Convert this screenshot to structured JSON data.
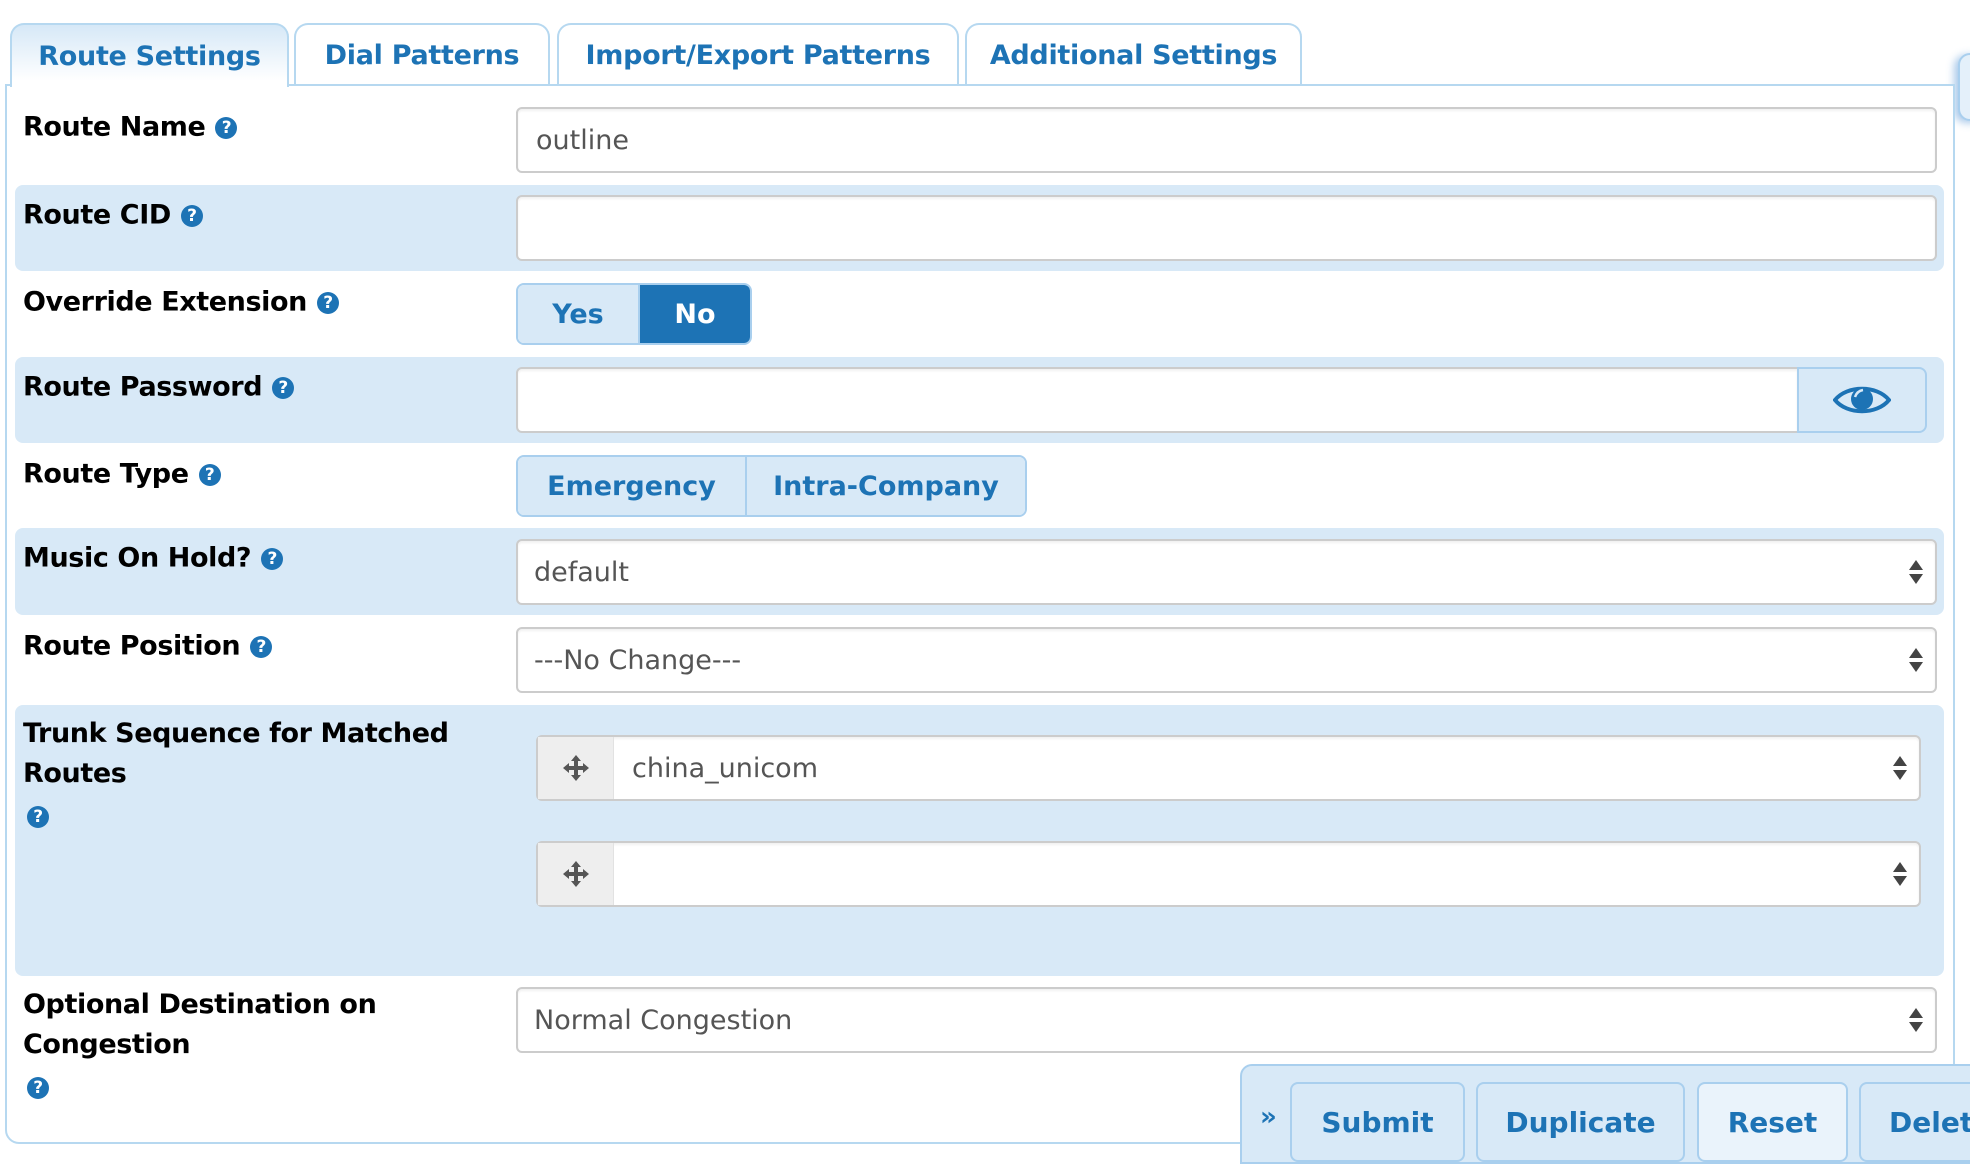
{
  "tabs": [
    {
      "label": "Route Settings",
      "active": true
    },
    {
      "label": "Dial Patterns",
      "active": false
    },
    {
      "label": "Import/Export Patterns",
      "active": false
    },
    {
      "label": "Additional Settings",
      "active": false
    }
  ],
  "help_glyph": "?",
  "fields": {
    "route_name": {
      "label": "Route Name",
      "value": "outline"
    },
    "route_cid": {
      "label": "Route CID",
      "value": ""
    },
    "override_extension": {
      "label": "Override Extension",
      "options": [
        "Yes",
        "No"
      ],
      "selected": "No"
    },
    "route_password": {
      "label": "Route Password",
      "value": "",
      "toggle_icon": "eye-icon"
    },
    "route_type": {
      "label": "Route Type",
      "options": [
        "Emergency",
        "Intra-Company"
      ]
    },
    "music_on_hold": {
      "label": "Music On Hold?",
      "value": "default"
    },
    "route_position": {
      "label": "Route Position",
      "value": "---No Change---"
    },
    "trunk_sequence": {
      "label_line1": "Trunk Sequence for Matched",
      "label_line2": "Routes",
      "trunks": [
        "china_unicom",
        ""
      ]
    },
    "congestion": {
      "label_line1": "Optional Destination on",
      "label_line2": "Congestion",
      "value": "Normal Congestion"
    }
  },
  "actions": {
    "expand_glyph": "»",
    "buttons": [
      "Submit",
      "Duplicate",
      "Reset",
      "Delet"
    ]
  },
  "colors": {
    "accent": "#1d73b5",
    "band": "#d8e9f7",
    "border": "#b6d8f0"
  }
}
